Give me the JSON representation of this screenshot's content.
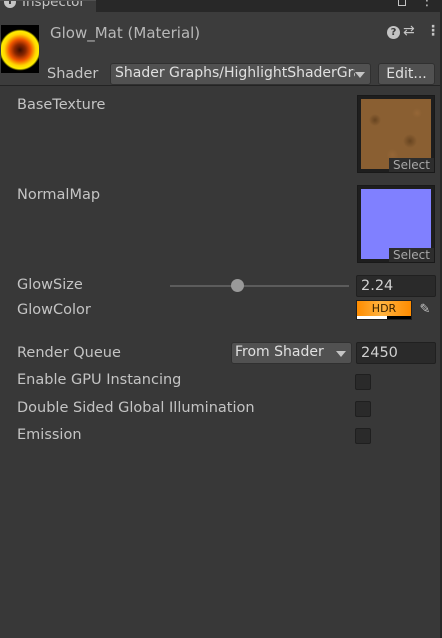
{
  "tab": {
    "title": "Inspector",
    "icon": "info-icon"
  },
  "header": {
    "title": "Glow_Mat (Material)",
    "shader_label": "Shader",
    "shader_value": "Shader Graphs/HighlightShaderGraph",
    "edit_label": "Edit...",
    "icons": [
      "help-icon",
      "preset-icon",
      "more-icon"
    ]
  },
  "properties": {
    "base_texture": {
      "label": "BaseTexture",
      "select_label": "Select"
    },
    "normal_map": {
      "label": "NormalMap",
      "select_label": "Select"
    },
    "glow_size": {
      "label": "GlowSize",
      "value": "2.24",
      "slider_fraction": 0.38
    },
    "glow_color": {
      "label": "GlowColor",
      "badge": "HDR",
      "color": "#ff9a1a"
    }
  },
  "advanced": {
    "render_queue": {
      "label": "Render Queue",
      "dropdown": "From Shader",
      "value": "2450"
    },
    "gpu_instancing": {
      "label": "Enable GPU Instancing",
      "checked": false
    },
    "double_sided_gi": {
      "label": "Double Sided Global Illumination",
      "checked": false
    },
    "emission": {
      "label": "Emission",
      "checked": false
    }
  },
  "colors": {
    "background": "#383838",
    "header": "#3c3c3c",
    "field": "#2a2a2a",
    "button": "#515151"
  }
}
